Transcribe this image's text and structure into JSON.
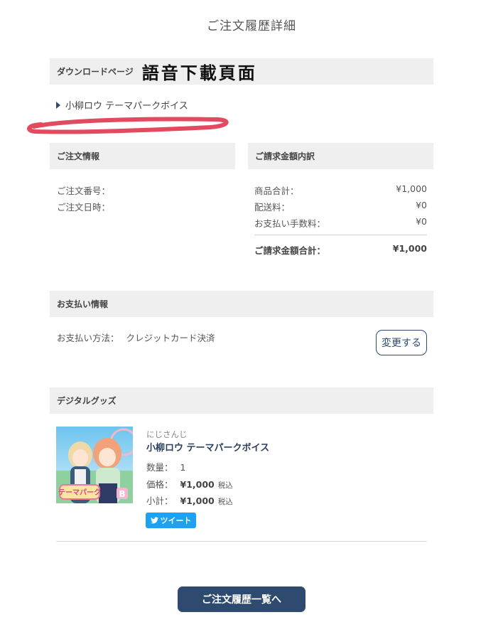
{
  "page": {
    "title": "ご注文履歴詳細"
  },
  "download": {
    "label": "ダウンロードページ",
    "annotation": "語音下載頁面",
    "link_text": "小柳ロウ テーマパークボイス"
  },
  "order_info": {
    "heading": "ご注文情報",
    "number_label": "ご注文番号：",
    "date_label": "ご注文日時："
  },
  "billing": {
    "heading": "ご請求金額内訳",
    "rows": [
      {
        "label": "商品合計：",
        "value": "¥1,000"
      },
      {
        "label": "配送料：",
        "value": "¥0"
      },
      {
        "label": "お支払い手数料：",
        "value": "¥0"
      }
    ],
    "total": {
      "label": "ご請求金額合計：",
      "value": "¥1,000"
    }
  },
  "payment": {
    "heading": "お支払い情報",
    "method_label": "お支払い方法：",
    "method_value": "クレジットカード決済",
    "change_label": "変更する"
  },
  "goods": {
    "heading": "デジタルグッズ",
    "item": {
      "shop": "にじさんじ",
      "name": "小柳ロウ テーマパークボイス",
      "qty_label": "数量：",
      "qty": "1",
      "price_label": "価格：",
      "price": "¥1,000",
      "price_tax": "税込",
      "subtotal_label": "小計：",
      "subtotal": "¥1,000",
      "subtotal_tax": "税込",
      "thumb_text": "テーマパーク",
      "thumb_badge": "B"
    },
    "tweet_label": "ツイート"
  },
  "footer": {
    "history_button": "ご注文履歴一覧へ"
  },
  "colors": {
    "navy": "#2e4a6e",
    "twitter": "#1da1f2",
    "scribble": "#e44a5f",
    "bar_bg": "#efefef"
  },
  "icons": {
    "tweet": "twitter-bird-icon",
    "link": "triangle-right-icon"
  }
}
